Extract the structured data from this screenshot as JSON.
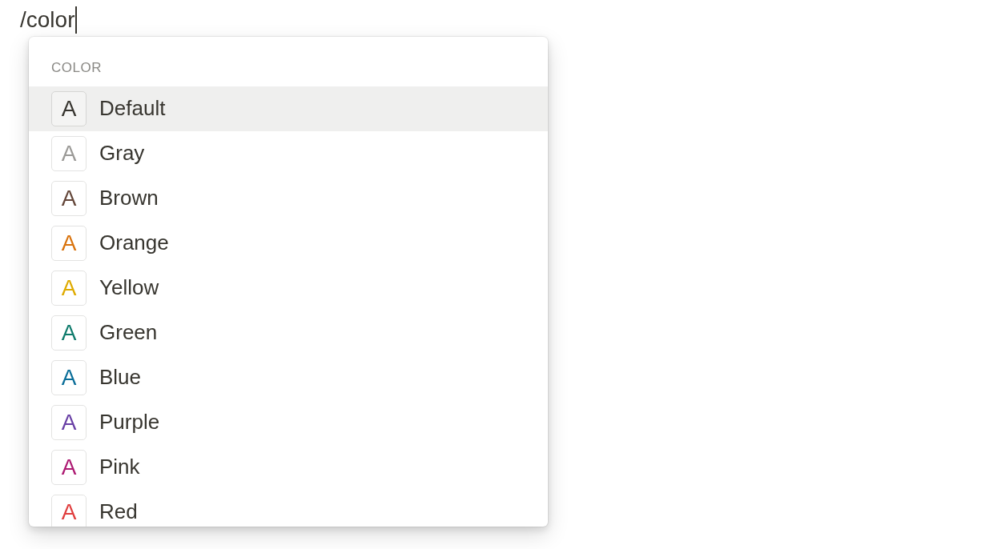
{
  "editor": {
    "typed_text": "/color"
  },
  "menu": {
    "section_header": "COLOR",
    "items": [
      {
        "glyph": "A",
        "label": "Default",
        "color": "#37352f",
        "selected": true
      },
      {
        "glyph": "A",
        "label": "Gray",
        "color": "#9b9a97",
        "selected": false
      },
      {
        "glyph": "A",
        "label": "Brown",
        "color": "#64473a",
        "selected": false
      },
      {
        "glyph": "A",
        "label": "Orange",
        "color": "#d9730d",
        "selected": false
      },
      {
        "glyph": "A",
        "label": "Yellow",
        "color": "#dfab01",
        "selected": false
      },
      {
        "glyph": "A",
        "label": "Green",
        "color": "#0f7b6c",
        "selected": false
      },
      {
        "glyph": "A",
        "label": "Blue",
        "color": "#0b6e99",
        "selected": false
      },
      {
        "glyph": "A",
        "label": "Purple",
        "color": "#6940a5",
        "selected": false
      },
      {
        "glyph": "A",
        "label": "Pink",
        "color": "#ad1a72",
        "selected": false
      },
      {
        "glyph": "A",
        "label": "Red",
        "color": "#e03e3e",
        "selected": false
      }
    ]
  }
}
